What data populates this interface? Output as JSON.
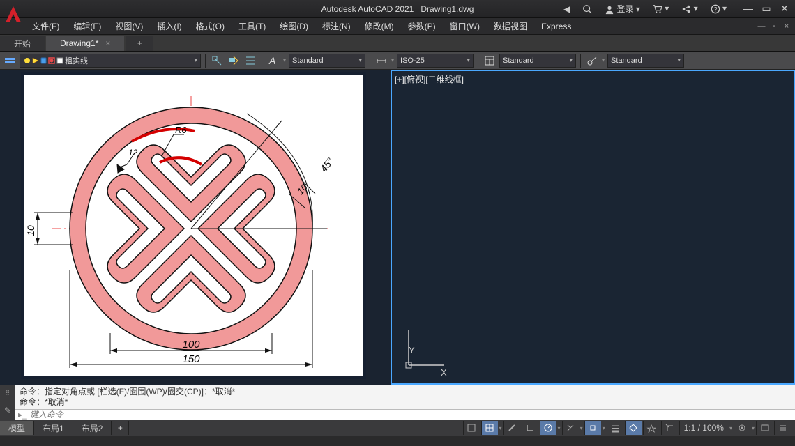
{
  "title": {
    "app": "Autodesk AutoCAD 2021",
    "file": "Drawing1.dwg"
  },
  "login": "登录",
  "menu": [
    "文件(F)",
    "编辑(E)",
    "视图(V)",
    "插入(I)",
    "格式(O)",
    "工具(T)",
    "绘图(D)",
    "标注(N)",
    "修改(M)",
    "参数(P)",
    "窗口(W)",
    "数据视图",
    "Express"
  ],
  "tabs": {
    "start": "开始",
    "active": "Drawing1*"
  },
  "layer": "粗实线",
  "textstyle": "Standard",
  "dimstyle": "ISO-25",
  "tablestyle": "Standard",
  "mleaderstyle": "Standard",
  "viewport_label": "[+][俯视][二维线框]",
  "axis": {
    "x": "X",
    "y": "Y"
  },
  "cmd_hist1": "命令：指定对角点或 [栏选(F)/圈围(WP)/圈交(CP)]：*取消*",
  "cmd_hist2": "命令：*取消*",
  "cmd_placeholder": "键入命令",
  "status_tabs": [
    "模型",
    "布局1",
    "布局2"
  ],
  "zoom": "1:1 / 100%",
  "chart_data": {
    "type": "cad-drawing",
    "dimensions": {
      "outer_diameter": 150,
      "inner_feature": 100,
      "offset": 10,
      "small_radius_R6": 6,
      "small_dim_12": 12,
      "angle": "45°"
    }
  }
}
